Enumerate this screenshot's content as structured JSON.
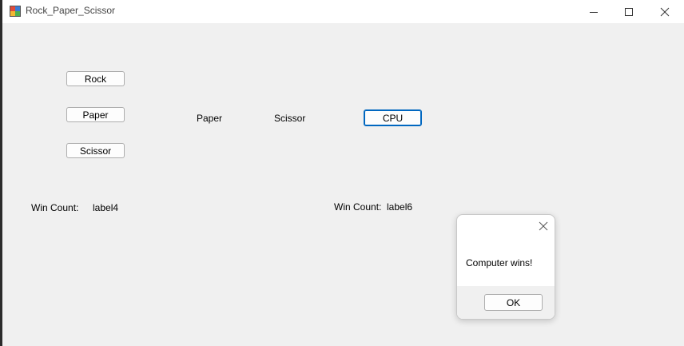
{
  "window": {
    "title": "Rock_Paper_Scissor",
    "controls": {
      "minimize": "minimize-icon",
      "maximize": "maximize-icon",
      "close": "close-icon"
    }
  },
  "buttons": {
    "rock": "Rock",
    "paper": "Paper",
    "scissor": "Scissor",
    "cpu": "CPU"
  },
  "labels": {
    "player_choice": "Paper",
    "cpu_choice": "Scissor",
    "player_win_label": "Win Count:",
    "player_win_value": "label4",
    "cpu_win_label": "Win Count:",
    "cpu_win_value": "label6"
  },
  "dialog": {
    "message": "Computer wins!",
    "ok_label": "OK"
  },
  "colors": {
    "form_bg": "#f0f0f0",
    "titlebar_bg": "#ffffff",
    "focus_border": "#0067c0"
  }
}
